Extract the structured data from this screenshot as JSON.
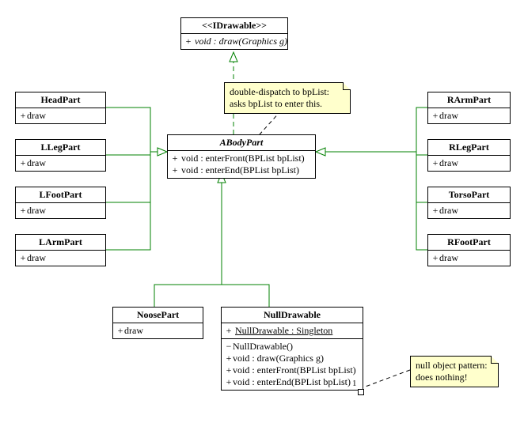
{
  "interface": {
    "stereotype": "<<IDrawable>>",
    "method_vis": "+",
    "method": "void : draw(Graphics g)"
  },
  "abody": {
    "name": "ABodyPart",
    "m1_vis": "+",
    "m1": "void : enterFront(BPList bpList)",
    "m2_vis": "+",
    "m2": "void : enterEnd(BPList bpList)"
  },
  "left_parts": {
    "head": {
      "name": "HeadPart",
      "vis": "+",
      "m": "draw"
    },
    "lleg": {
      "name": "LLegPart",
      "vis": "+",
      "m": "draw"
    },
    "lfoot": {
      "name": "LFootPart",
      "vis": "+",
      "m": "draw"
    },
    "larm": {
      "name": "LArmPart",
      "vis": "+",
      "m": "draw"
    }
  },
  "right_parts": {
    "rarm": {
      "name": "RArmPart",
      "vis": "+",
      "m": "draw"
    },
    "rleg": {
      "name": "RLegPart",
      "vis": "+",
      "m": "draw"
    },
    "torso": {
      "name": "TorsoPart",
      "vis": "+",
      "m": "draw"
    },
    "rfoot": {
      "name": "RFootPart",
      "vis": "+",
      "m": "draw"
    }
  },
  "noose": {
    "name": "NoosePart",
    "vis": "+",
    "m": "draw"
  },
  "nulldraw": {
    "name": "NullDrawable",
    "attr_vis": "+",
    "attr": "NullDrawable : Singleton",
    "ctor_vis": "−",
    "ctor": "NullDrawable()",
    "m1_vis": "+",
    "m1": "void : draw(Graphics g)",
    "m2_vis": "+",
    "m2": "void : enterFront(BPList bpList)",
    "m3_vis": "+",
    "m3": "void : enterEnd(BPList bpList)"
  },
  "notes": {
    "dispatch1": "double-dispatch to bpList:",
    "dispatch2": "asks bpList to enter this.",
    "null1": "null object pattern:",
    "null2": "does nothing!"
  },
  "mult_null": "1"
}
